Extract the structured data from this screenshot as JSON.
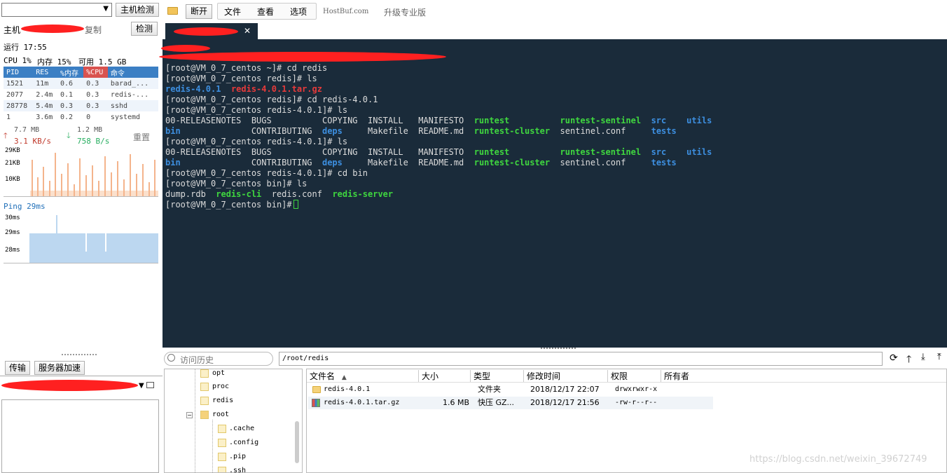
{
  "left_panel": {
    "host_check_button": "主机检测",
    "host_label": "主机",
    "copy_label": "复制",
    "check_button": "检测",
    "uptime": "运行 17:55",
    "cpu": "CPU 1%",
    "mem": "内存 15%",
    "avail": "可用 1.5 GB",
    "proc_headers": [
      "PID",
      "RES",
      "%内存",
      "%CPU",
      "命令"
    ],
    "procs": [
      [
        "1521",
        "11m",
        "0.6",
        "0.3",
        "barad_..."
      ],
      [
        "2077",
        "2.4m",
        "0.1",
        "0.3",
        "redis-..."
      ],
      [
        "28778",
        "5.4m",
        "0.3",
        "0.3",
        "sshd"
      ],
      [
        "1",
        "3.6m",
        "0.2",
        "0",
        "systemd"
      ]
    ],
    "net_up_total": "7.7 MB",
    "net_down_total": "1.2 MB",
    "net_up_rate": "3.1 KB/s",
    "net_down_rate": "758 B/s",
    "reset_button": "重置",
    "net_ticks": [
      "29KB",
      "21KB",
      "10KB"
    ],
    "ping": "Ping 29ms",
    "ping_ticks": [
      "30ms",
      "29ms",
      "28ms"
    ],
    "tab_transfer": "传输",
    "tab_accel": "服务器加速"
  },
  "toolbar": {
    "disconnect": "断开",
    "file": "文件",
    "view": "查看",
    "options": "选项",
    "brand": "HostBuf.com",
    "upgrade": "升级专业版",
    "tab_close": "✕"
  },
  "terminal": {
    "lines": [
      [
        {
          "t": "[root@VM_0_7_centos ~]# cd redis",
          "c": "c-white"
        }
      ],
      [
        {
          "t": "[root@VM_0_7_centos redis]# ls",
          "c": "c-white"
        }
      ],
      [
        {
          "t": "redis-4.0.1",
          "c": "c-blue"
        },
        {
          "t": "  ",
          "c": "c-white"
        },
        {
          "t": "redis-4.0.1.tar.gz",
          "c": "c-red"
        }
      ],
      [
        {
          "t": "[root@VM_0_7_centos redis]# cd redis-4.0.1",
          "c": "c-white"
        }
      ],
      [
        {
          "t": "[root@VM_0_7_centos redis-4.0.1]# ls",
          "c": "c-white"
        }
      ],
      [
        {
          "t": "00-RELEASENOTES  BUGS          COPYING  INSTALL   MANIFESTO  ",
          "c": "c-white"
        },
        {
          "t": "runtest",
          "c": "c-green"
        },
        {
          "t": "          ",
          "c": "c-white"
        },
        {
          "t": "runtest-sentinel",
          "c": "c-green"
        },
        {
          "t": "  ",
          "c": "c-white"
        },
        {
          "t": "src",
          "c": "c-blue"
        },
        {
          "t": "    ",
          "c": "c-white"
        },
        {
          "t": "utils",
          "c": "c-blue"
        }
      ],
      [
        {
          "t": "bin",
          "c": "c-blue"
        },
        {
          "t": "              CONTRIBUTING  ",
          "c": "c-white"
        },
        {
          "t": "deps",
          "c": "c-blue"
        },
        {
          "t": "     Makefile  README.md  ",
          "c": "c-white"
        },
        {
          "t": "runtest-cluster",
          "c": "c-green"
        },
        {
          "t": "  sentinel.conf     ",
          "c": "c-white"
        },
        {
          "t": "tests",
          "c": "c-blue"
        }
      ],
      [
        {
          "t": "[root@VM_0_7_centos redis-4.0.1]# ls",
          "c": "c-white"
        }
      ],
      [
        {
          "t": "00-RELEASENOTES  BUGS          COPYING  INSTALL   MANIFESTO  ",
          "c": "c-white"
        },
        {
          "t": "runtest",
          "c": "c-green"
        },
        {
          "t": "          ",
          "c": "c-white"
        },
        {
          "t": "runtest-sentinel",
          "c": "c-green"
        },
        {
          "t": "  ",
          "c": "c-white"
        },
        {
          "t": "src",
          "c": "c-blue"
        },
        {
          "t": "    ",
          "c": "c-white"
        },
        {
          "t": "utils",
          "c": "c-blue"
        }
      ],
      [
        {
          "t": "bin",
          "c": "c-blue"
        },
        {
          "t": "              CONTRIBUTING  ",
          "c": "c-white"
        },
        {
          "t": "deps",
          "c": "c-blue"
        },
        {
          "t": "     Makefile  README.md  ",
          "c": "c-white"
        },
        {
          "t": "runtest-cluster",
          "c": "c-green"
        },
        {
          "t": "  sentinel.conf     ",
          "c": "c-white"
        },
        {
          "t": "tests",
          "c": "c-blue"
        }
      ],
      [
        {
          "t": "[root@VM_0_7_centos redis-4.0.1]# cd bin",
          "c": "c-white"
        }
      ],
      [
        {
          "t": "[root@VM_0_7_centos bin]# ls",
          "c": "c-white"
        }
      ],
      [
        {
          "t": "dump.rdb  ",
          "c": "c-white"
        },
        {
          "t": "redis-cli",
          "c": "c-green"
        },
        {
          "t": "  redis.conf  ",
          "c": "c-white"
        },
        {
          "t": "redis-server",
          "c": "c-green"
        }
      ],
      [
        {
          "t": "[root@VM_0_7_centos bin]# ",
          "c": "c-white"
        }
      ]
    ]
  },
  "file_manager": {
    "history_placeholder": "访问历史",
    "path": "/root/redis",
    "tree": [
      "opt",
      "proc",
      "redis",
      "root",
      ".cache",
      ".config",
      ".pip",
      ".ssh"
    ],
    "headers": [
      "文件名",
      "大小",
      "类型",
      "修改时间",
      "权限",
      "所有者"
    ],
    "rows": [
      {
        "name": "redis-4.0.1",
        "size": "",
        "type": "文件夹",
        "mtime": "2018/12/17 22:07",
        "perm": "drwxrwxr-x"
      },
      {
        "name": "redis-4.0.1.tar.gz",
        "size": "1.6 MB",
        "type": "快压 GZ...",
        "mtime": "2018/12/17 21:56",
        "perm": "-rw-r--r--"
      }
    ]
  },
  "watermark": "https://blog.csdn.net/weixin_39672749"
}
